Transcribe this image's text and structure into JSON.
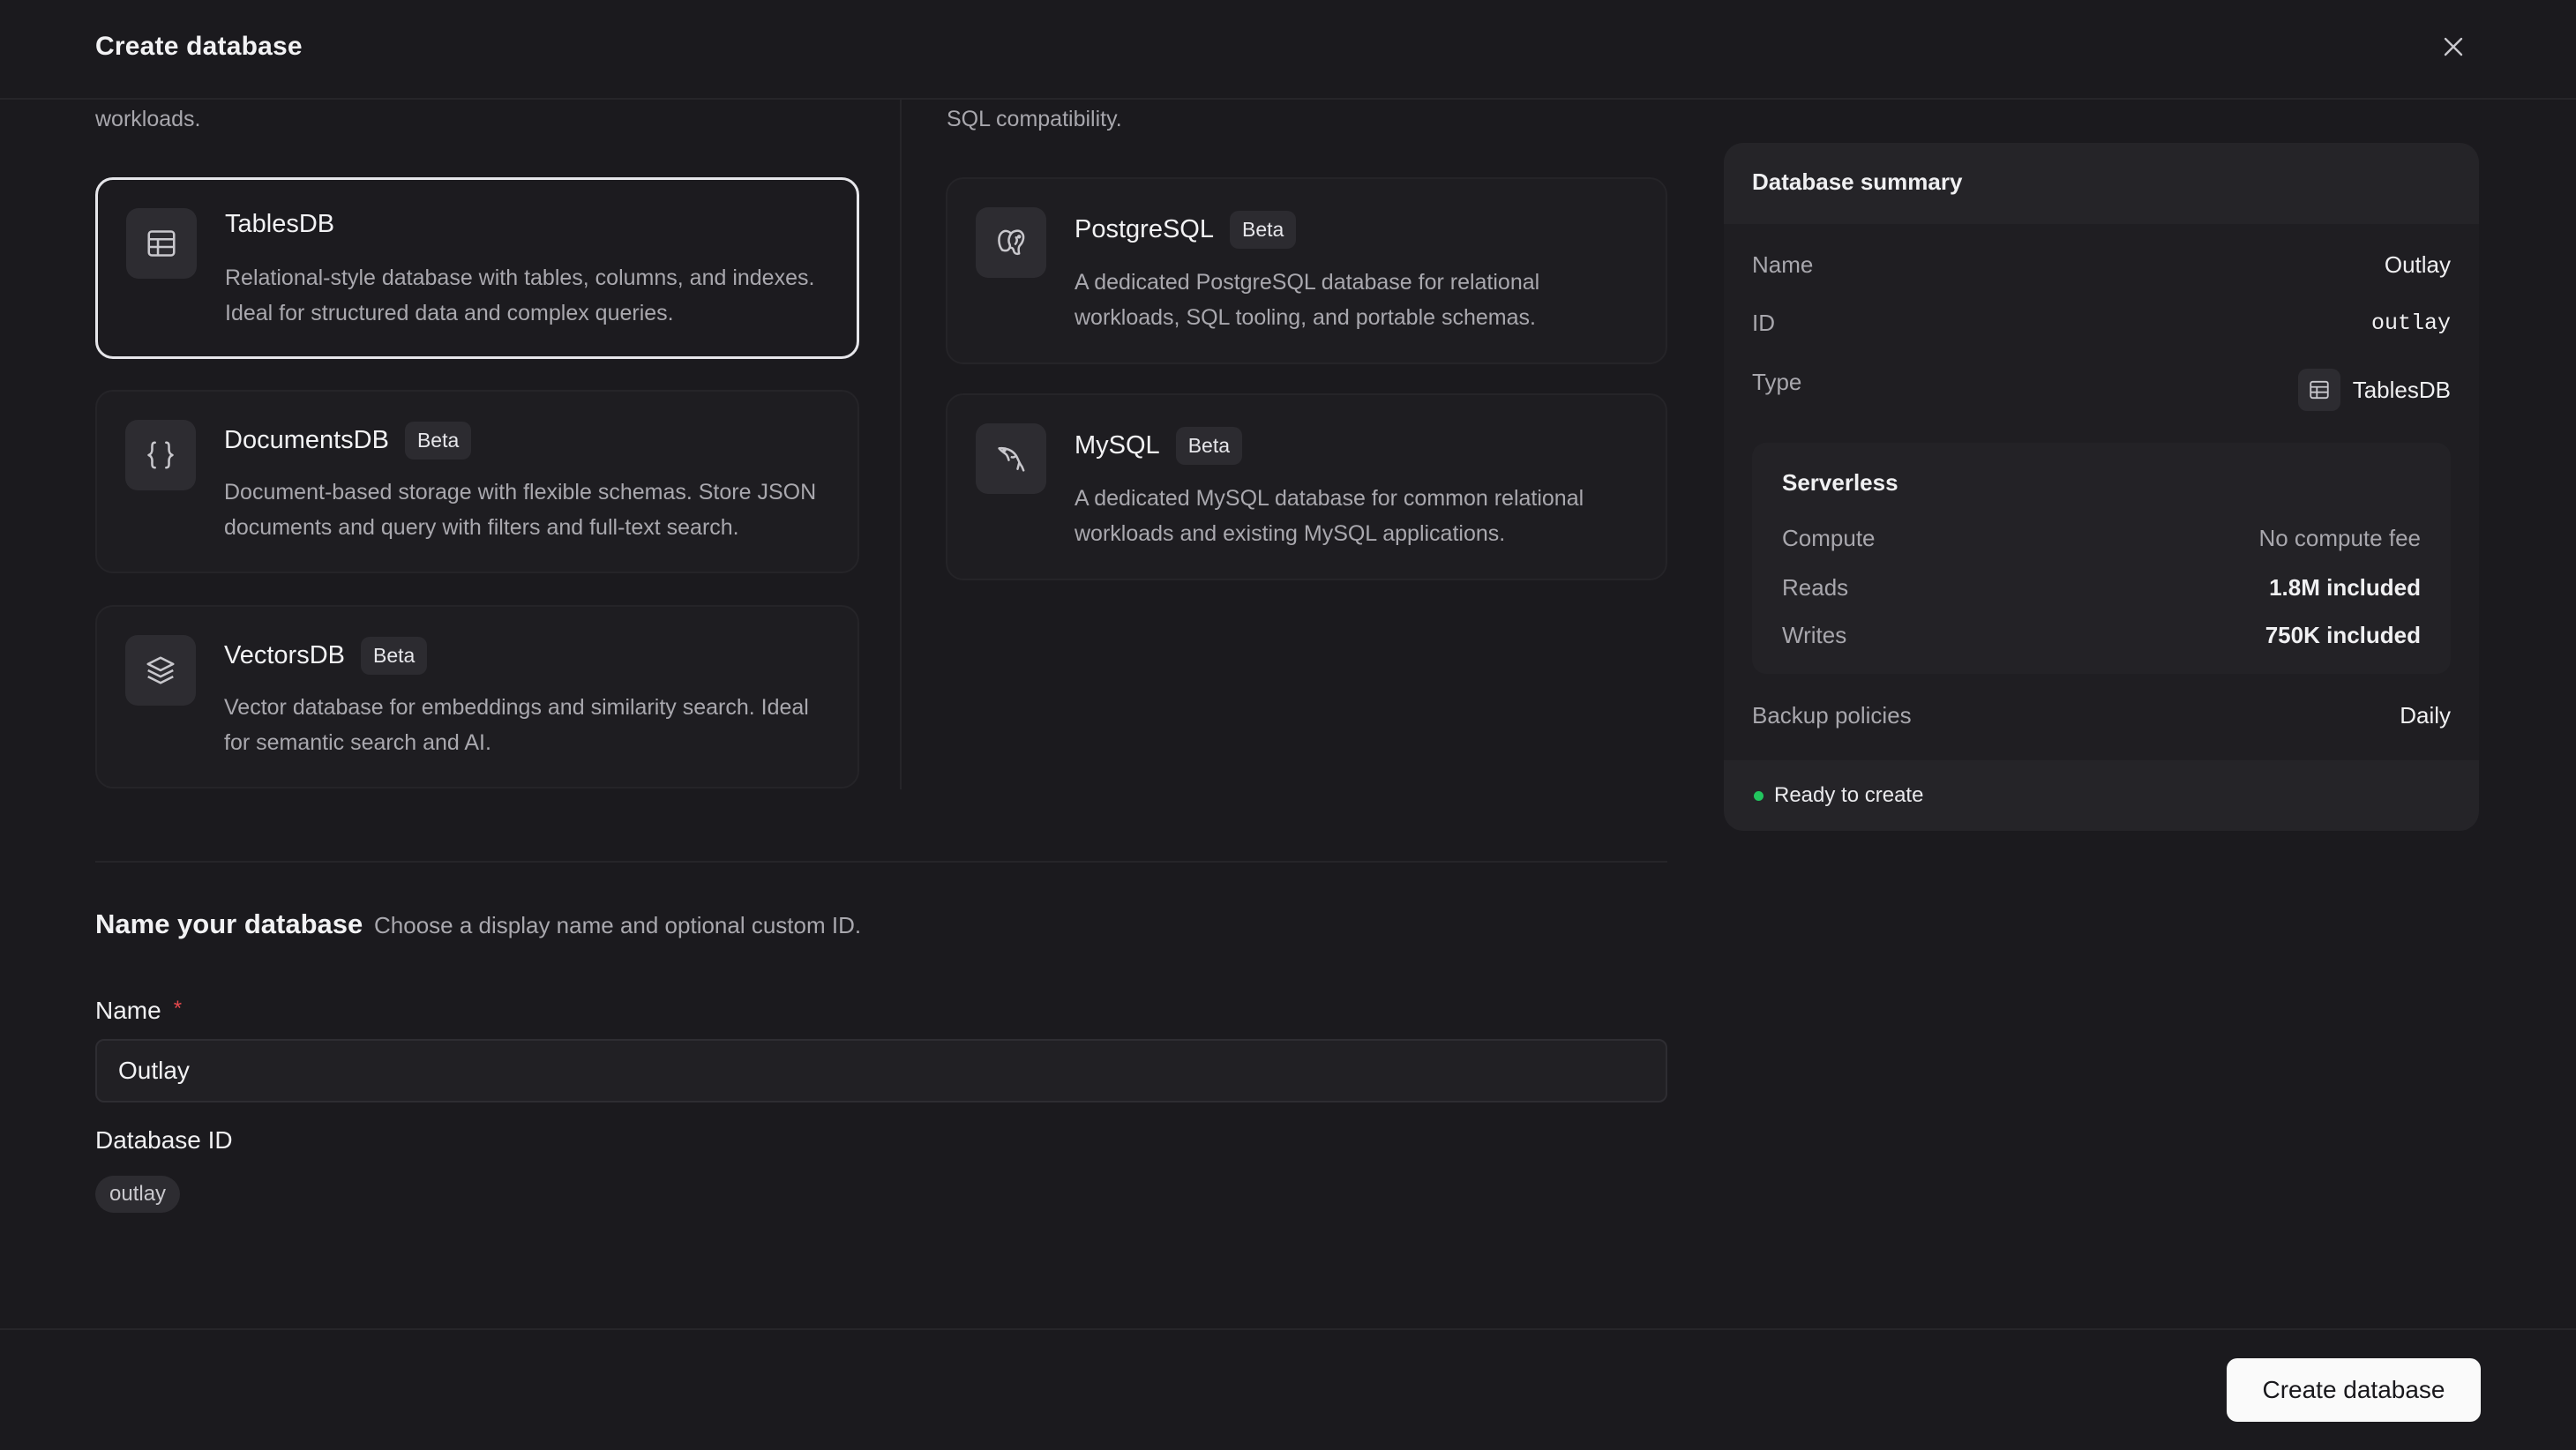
{
  "dialog": {
    "title": "Create database"
  },
  "left_col_cut_text": "workloads.",
  "right_col_cut_text": "SQL compatibility.",
  "db_types": [
    {
      "name": "TablesDB",
      "badge": "",
      "icon": "table-icon",
      "selected": true,
      "desc_line1": "Relational-style database with tables, columns, and indexes.",
      "desc_line2": "Ideal for structured data and complex queries."
    },
    {
      "name": "DocumentsDB",
      "badge": "Beta",
      "icon": "braces-icon",
      "selected": false,
      "desc_line1": "Document-based storage with flexible schemas. Store JSON",
      "desc_line2": "documents and query with filters and full-text search."
    },
    {
      "name": "VectorsDB",
      "badge": "Beta",
      "icon": "layers-icon",
      "selected": false,
      "desc_line1": "Vector database for embeddings and similarity search. Ideal",
      "desc_line2": "for semantic search and AI."
    },
    {
      "name": "PostgreSQL",
      "badge": "Beta",
      "icon": "elephant-icon",
      "selected": false,
      "desc_line1": "A dedicated PostgreSQL database for relational",
      "desc_line2": "workloads, SQL tooling, and portable schemas."
    },
    {
      "name": "MySQL",
      "badge": "Beta",
      "icon": "dolphin-icon",
      "selected": false,
      "desc_line1": "A dedicated MySQL database for common relational",
      "desc_line2": "workloads and existing MySQL applications."
    }
  ],
  "summary": {
    "title": "Database summary",
    "name_label": "Name",
    "name_value": "Outlay",
    "id_label": "ID",
    "id_value": "outlay",
    "type_label": "Type",
    "type_value": "TablesDB",
    "serverless": {
      "title": "Serverless",
      "compute_label": "Compute",
      "compute_value": "No compute fee",
      "reads_label": "Reads",
      "reads_value": "1.8M included",
      "writes_label": "Writes",
      "writes_value": "750K included"
    },
    "backup_label": "Backup policies",
    "backup_value": "Daily",
    "status": "Ready to create",
    "status_color": "#22c55e"
  },
  "naming": {
    "title": "Name your database",
    "subtitle": "Choose a display name and optional custom ID.",
    "name_label": "Name",
    "required_mark": "*",
    "name_value": "Outlay",
    "id_label": "Database ID",
    "id_value": "outlay"
  },
  "footer": {
    "create_label": "Create database"
  }
}
